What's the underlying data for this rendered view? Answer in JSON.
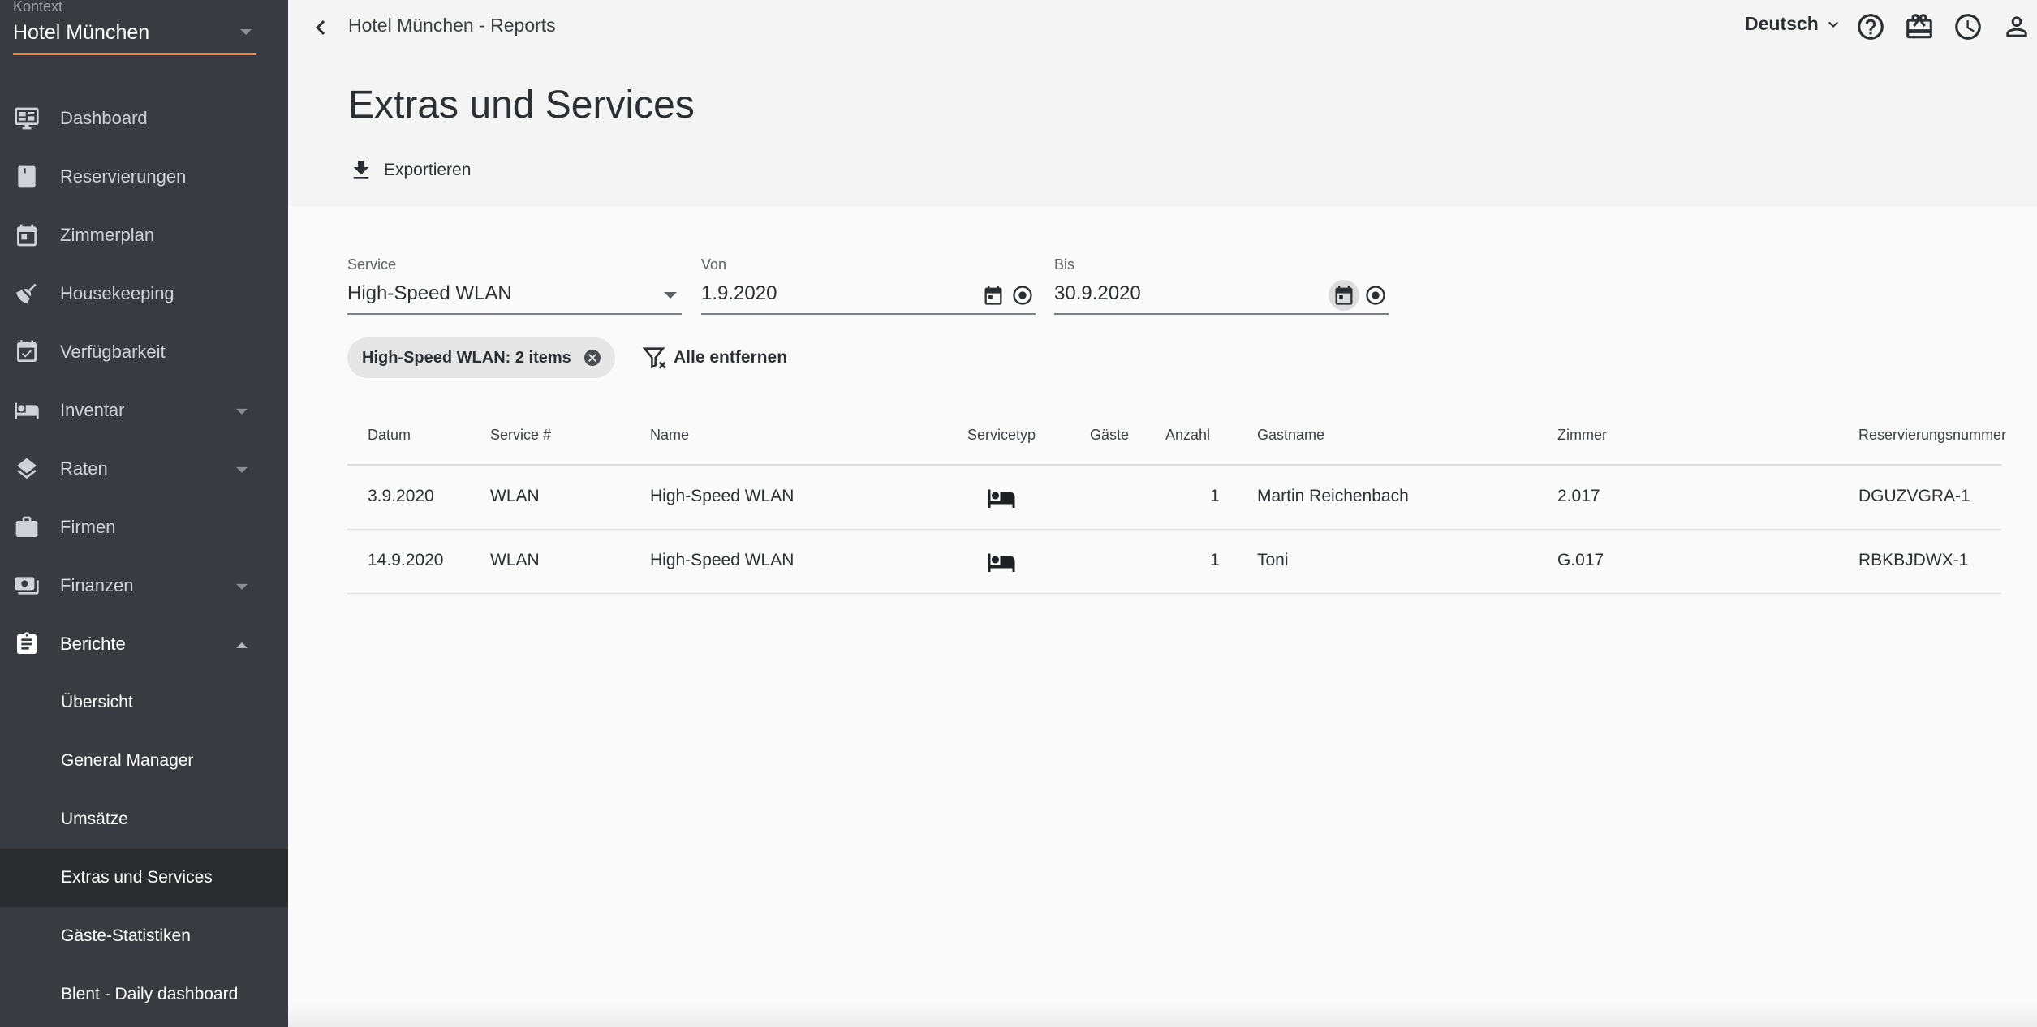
{
  "sidebar": {
    "context_label": "Kontext",
    "context_value": "Hotel München",
    "items": [
      {
        "label": "Dashboard",
        "icon": "monitor-dashboard-icon"
      },
      {
        "label": "Reservierungen",
        "icon": "book-icon"
      },
      {
        "label": "Zimmerplan",
        "icon": "calendar-icon"
      },
      {
        "label": "Housekeeping",
        "icon": "broom-icon"
      },
      {
        "label": "Verfügbarkeit",
        "icon": "calendar-check-icon"
      },
      {
        "label": "Inventar",
        "icon": "hotel-bed-icon"
      },
      {
        "label": "Raten",
        "icon": "layers-icon"
      },
      {
        "label": "Firmen",
        "icon": "briefcase-icon"
      },
      {
        "label": "Finanzen",
        "icon": "money-icon"
      },
      {
        "label": "Berichte",
        "icon": "clipboard-icon"
      }
    ],
    "sub_items": [
      {
        "label": "Übersicht"
      },
      {
        "label": "General Manager"
      },
      {
        "label": "Umsätze"
      },
      {
        "label": "Extras und Services"
      },
      {
        "label": "Gäste-Statistiken"
      },
      {
        "label": "Blent - Daily dashboard"
      }
    ]
  },
  "header": {
    "breadcrumb": "Hotel München - Reports",
    "title": "Extras und Services",
    "export_label": "Exportieren",
    "language": "Deutsch"
  },
  "filters": {
    "service_label": "Service",
    "service_value": "High-Speed WLAN",
    "from_label": "Von",
    "from_value": "1.9.2020",
    "to_label": "Bis",
    "to_value": "30.9.2020",
    "chip_label": "High-Speed WLAN: 2 items",
    "clear_all_label": "Alle entfernen"
  },
  "table": {
    "columns": [
      "Datum",
      "Service #",
      "Name",
      "Servicetyp",
      "Gäste",
      "Anzahl",
      "Gastname",
      "Zimmer",
      "Reservierungsnummer"
    ],
    "rows": [
      {
        "date": "3.9.2020",
        "service_no": "WLAN",
        "name": "High-Speed WLAN",
        "service_type_icon": "hotel-bed-icon",
        "guests": "",
        "count": "1",
        "guest_name": "Martin Reichenbach",
        "room": "2.017",
        "reservation_no": "DGUZVGRA-1"
      },
      {
        "date": "14.9.2020",
        "service_no": "WLAN",
        "name": "High-Speed WLAN",
        "service_type_icon": "hotel-bed-icon",
        "guests": "",
        "count": "1",
        "guest_name": "Toni",
        "room": "G.017",
        "reservation_no": "RBKBJDWX-1"
      }
    ]
  },
  "colors": {
    "sidebar_bg": "#383b40",
    "accent": "#ef7d2d",
    "active_item_bg": "#2a2c30",
    "header_bg": "#f4f4f4"
  }
}
